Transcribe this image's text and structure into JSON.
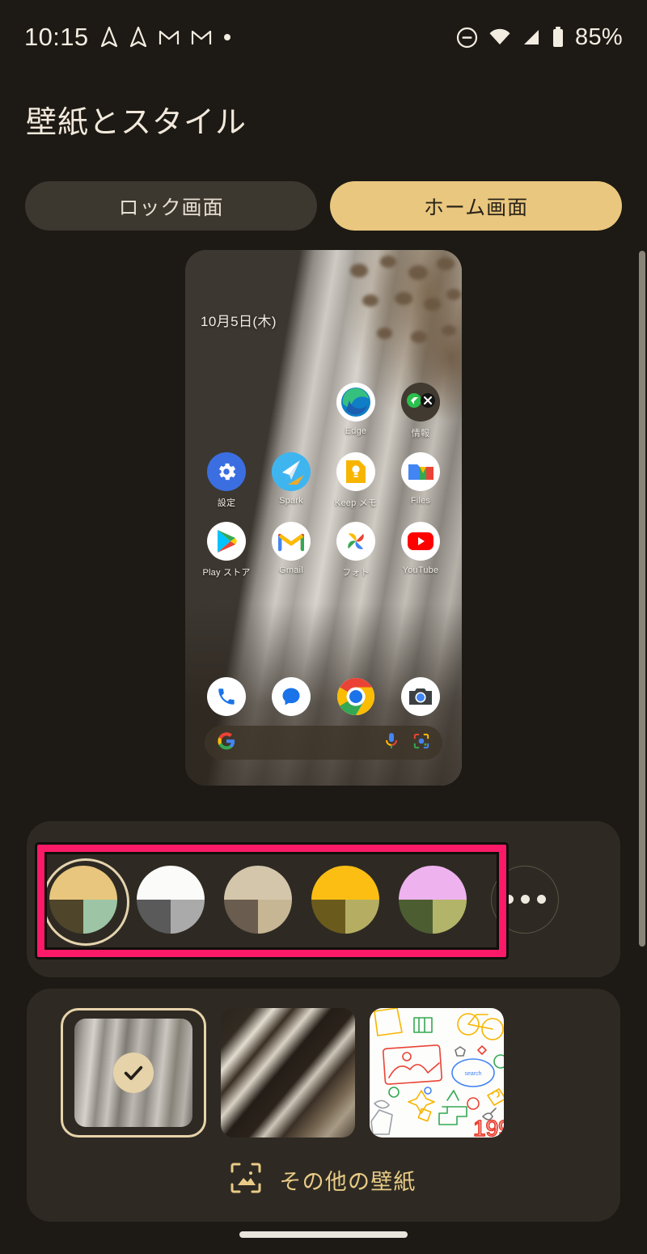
{
  "status_bar": {
    "time": "10:15",
    "battery_percent": "85%",
    "left_icons": [
      "navigation-arrow-icon",
      "navigation-arrow-icon",
      "gmail-m-icon",
      "gmail-m-icon",
      "dot-icon"
    ],
    "right_icons": [
      "do-not-disturb-icon",
      "wifi-icon",
      "cellular-signal-icon",
      "battery-icon"
    ]
  },
  "header": {
    "title": "壁紙とスタイル"
  },
  "tabs": [
    {
      "label": "ロック画面",
      "active": false
    },
    {
      "label": "ホーム画面",
      "active": true
    }
  ],
  "preview": {
    "date_widget": "10月5日(木)",
    "rows": [
      [
        {
          "label": "",
          "icon": "empty"
        },
        {
          "label": "",
          "icon": "empty"
        },
        {
          "label": "Edge",
          "icon": "edge-icon"
        },
        {
          "label": "情報",
          "icon": "folder-icon"
        }
      ],
      [
        {
          "label": "設定",
          "icon": "settings-icon"
        },
        {
          "label": "Spark",
          "icon": "spark-icon"
        },
        {
          "label": "Keep メモ",
          "icon": "keep-icon"
        },
        {
          "label": "Files",
          "icon": "files-icon"
        }
      ],
      [
        {
          "label": "Play ストア",
          "icon": "play-store-icon"
        },
        {
          "label": "Gmail",
          "icon": "gmail-icon"
        },
        {
          "label": "フォト",
          "icon": "photos-icon"
        },
        {
          "label": "YouTube",
          "icon": "youtube-icon"
        }
      ]
    ],
    "dock": [
      {
        "label": "",
        "icon": "phone-icon"
      },
      {
        "label": "",
        "icon": "messages-icon"
      },
      {
        "label": "",
        "icon": "chrome-icon"
      },
      {
        "label": "",
        "icon": "camera-icon"
      }
    ],
    "search_bar": {
      "logo": "google-g-icon",
      "mic": "microphone-icon",
      "lens": "google-lens-icon",
      "value": "",
      "placeholder": ""
    }
  },
  "color_section": {
    "swatches": [
      {
        "name": "tan-olive-sage",
        "selected": true,
        "top": "#e9c67d",
        "bottom_left": "#4e452a",
        "bottom_right": "#9dc4a4"
      },
      {
        "name": "white-grey",
        "selected": false,
        "top": "#fbfbfa",
        "bottom_left": "#5a5a5a",
        "bottom_right": "#aaaaaa"
      },
      {
        "name": "beige-brown",
        "selected": false,
        "top": "#d4c6ab",
        "bottom_left": "#6a5c4e",
        "bottom_right": "#c6b694"
      },
      {
        "name": "amber-olive",
        "selected": false,
        "top": "#fcbe13",
        "bottom_left": "#6a5b1d",
        "bottom_right": "#b5ae62"
      },
      {
        "name": "pink-green",
        "selected": false,
        "top": "#eeb2ef",
        "bottom_left": "#4c5e31",
        "bottom_right": "#b2b469"
      }
    ],
    "more_button": "more-colors-button",
    "annotation": {
      "color": "#fa1a67",
      "shape": "rectangle"
    }
  },
  "wallpaper_section": {
    "thumbnails": [
      {
        "name": "wallpaper-feather-light",
        "selected": true,
        "check": "check-icon"
      },
      {
        "name": "wallpaper-feather-dark",
        "selected": false,
        "check": ""
      },
      {
        "name": "wallpaper-doodle",
        "selected": false,
        "check": ""
      }
    ],
    "more_wallpapers": {
      "label": "その他の壁紙",
      "icon": "image-frame-icon",
      "color": "#e9cb86"
    }
  },
  "navigation": {
    "gesture_bar": "home-gesture-bar"
  }
}
